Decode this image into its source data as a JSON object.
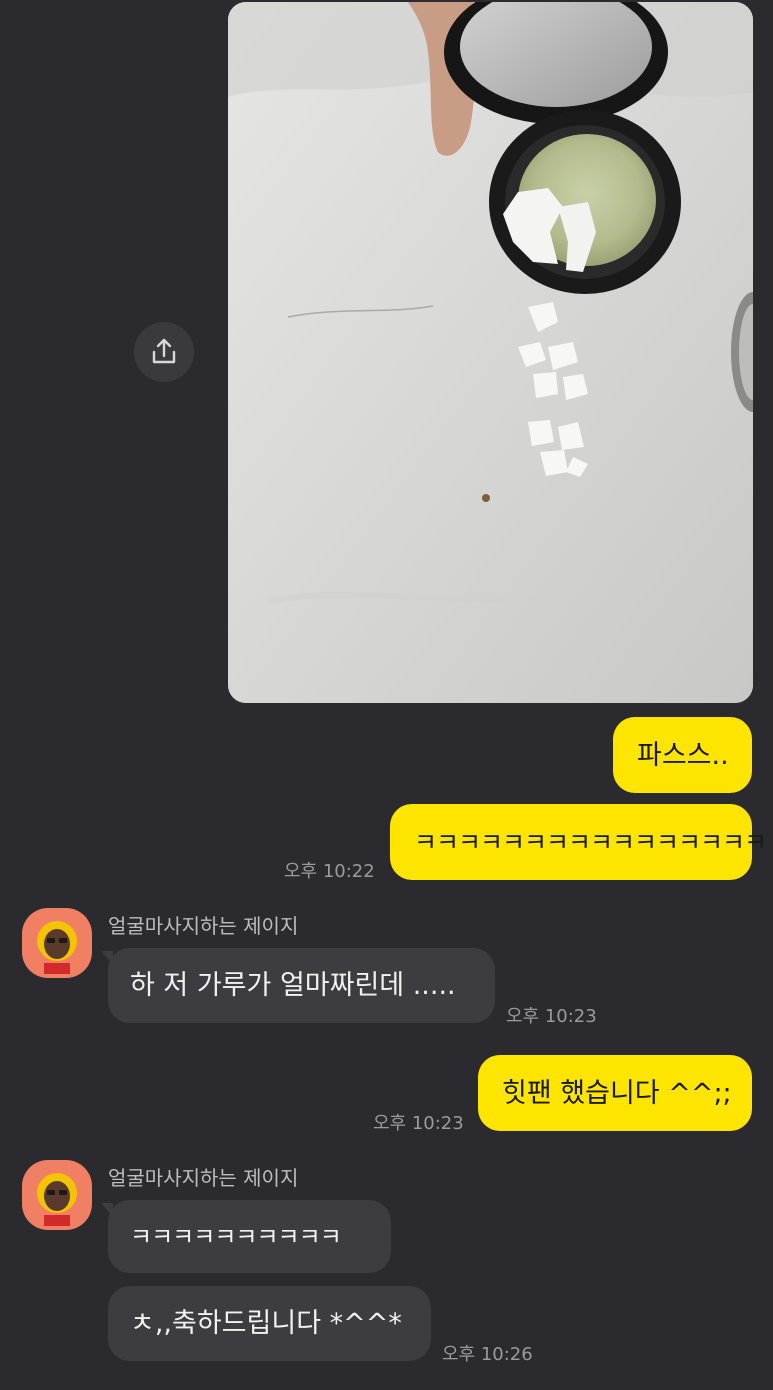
{
  "share": {
    "icon": "share-icon"
  },
  "messages": {
    "m1": {
      "text": "파스스.."
    },
    "m2": {
      "text": "ㅋㅋㅋㅋㅋㅋㅋㅋㅋㅋㅋㅋㅋㅋㅋㅋ",
      "time": "오후 10:22"
    },
    "m3": {
      "sender": "얼굴마사지하는 제이지",
      "text": "하 저 가루가 얼마짜린데 .....",
      "time": "오후 10:23"
    },
    "m4": {
      "text": "힛팬 했습니다 ^^;;",
      "time": "오후 10:23"
    },
    "m5": {
      "sender": "얼굴마사지하는 제이지",
      "text": "ㅋㅋㅋㅋㅋㅋㅋㅋㅋㅋ"
    },
    "m6": {
      "text": "ㅊ,,축하드립니다 *^^*",
      "time": "오후 10:26"
    }
  },
  "colors": {
    "background": "#2b2b2f",
    "my_bubble": "#fee500",
    "other_bubble": "#3d3d41",
    "avatar_bg": "#f07f63"
  }
}
